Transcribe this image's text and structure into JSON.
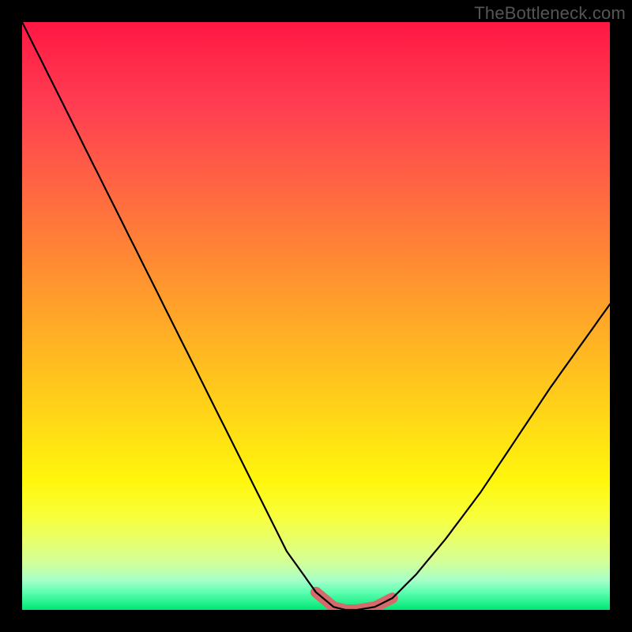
{
  "watermark": "TheBottleneck.com",
  "chart_data": {
    "type": "line",
    "title": "",
    "xlabel": "",
    "ylabel": "",
    "xlim": [
      0,
      100
    ],
    "ylim": [
      0,
      100
    ],
    "series": [
      {
        "name": "bottleneck-curve",
        "x": [
          0,
          5,
          10,
          15,
          20,
          25,
          30,
          35,
          40,
          45,
          50,
          53,
          55,
          57,
          60,
          63,
          67,
          72,
          78,
          84,
          90,
          95,
          100
        ],
        "values": [
          100,
          90,
          80,
          70,
          60,
          50,
          40,
          30,
          20,
          10,
          3,
          0.5,
          0,
          0,
          0.5,
          2,
          6,
          12,
          20,
          29,
          38,
          45,
          52
        ]
      }
    ],
    "highlight_band": {
      "x_start": 50,
      "x_end": 63,
      "color": "#d46a6a"
    },
    "background_gradient": {
      "direction": "vertical",
      "stops": [
        {
          "pos": 0,
          "color": "#ff1744"
        },
        {
          "pos": 50,
          "color": "#ffb124"
        },
        {
          "pos": 80,
          "color": "#fff60c"
        },
        {
          "pos": 100,
          "color": "#00e676"
        }
      ]
    }
  }
}
